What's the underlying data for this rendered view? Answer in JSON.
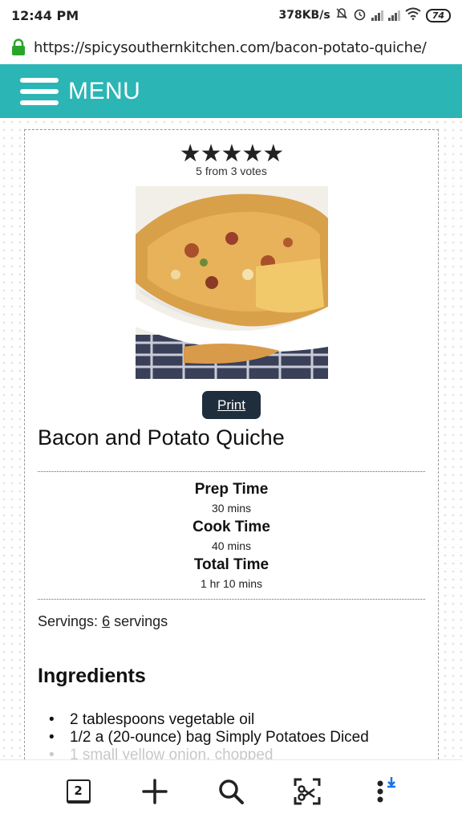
{
  "status_bar": {
    "time": "12:44 PM",
    "speed": "378KB/s",
    "battery": "74"
  },
  "browser": {
    "url": "https://spicysouthernkitchen.com/bacon-potato-quiche/",
    "tab_count": "2"
  },
  "site": {
    "menu_label": "MENU",
    "accent": "#2bb5b5"
  },
  "recipe": {
    "stars": "★★★★★",
    "votes": "5 from 3 votes",
    "print_label": "Print",
    "title": "Bacon and Potato Quiche",
    "prep_label": "Prep Time",
    "prep_value": "30 mins",
    "cook_label": "Cook Time",
    "cook_value": "40 mins",
    "total_label": "Total Time",
    "total_value": "1 hr 10 mins",
    "servings_prefix": "Servings:",
    "servings_count": "6",
    "servings_unit": "servings",
    "ingredients_heading": "Ingredients",
    "ingredients": [
      "2 tablespoons vegetable oil",
      "1/2 a (20-ounce) bag Simply Potatoes Diced",
      "1 small yellow onion, chopped"
    ]
  }
}
